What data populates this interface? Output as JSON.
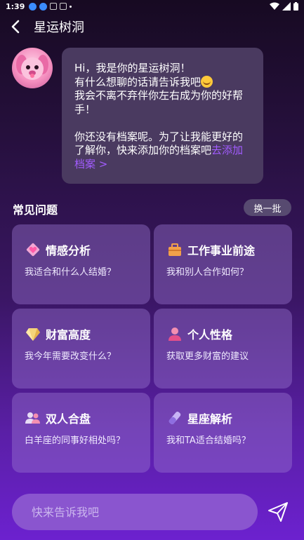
{
  "status_bar": {
    "time": "1:39"
  },
  "header": {
    "title": "星运树洞"
  },
  "greeting": {
    "line1": "Hi，我是你的星运树洞！",
    "line2": "有什么想聊的话请告诉我吧",
    "line3": "我会不离不弃伴你左右成为你的好帮手！",
    "line4": "你还没有档案呢。为了让我能更好的了解你，快来添加你的档案吧",
    "link": "去添加档案 >"
  },
  "faq": {
    "title": "常见问题",
    "refresh_label": "换一批",
    "cards": [
      {
        "title": "情感分析",
        "question": "我适合和什么人结婚？",
        "icon": "heart-icon"
      },
      {
        "title": "工作事业前途",
        "question": "我和别人合作如何？",
        "icon": "briefcase-icon"
      },
      {
        "title": "财富高度",
        "question": "我今年需要改变什么？",
        "icon": "gem-icon"
      },
      {
        "title": "个人性格",
        "question": "获取更多财富的建议",
        "icon": "person-icon"
      },
      {
        "title": "双人合盘",
        "question": "白羊座的同事好相处吗？",
        "icon": "couple-icon"
      },
      {
        "title": "星座解析",
        "question": "我和TA适合结婚吗？",
        "icon": "crystal-icon"
      }
    ]
  },
  "input": {
    "placeholder": "快来告诉我吧"
  },
  "colors": {
    "accent": "#a25cff",
    "card_bg": "#9c78d2",
    "bubble_bg": "#4a3a60"
  }
}
